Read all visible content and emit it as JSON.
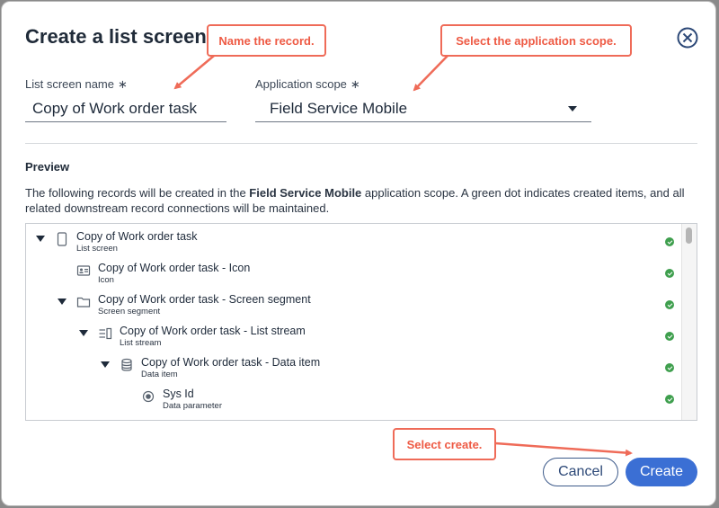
{
  "dialog": {
    "title": "Create a list screen"
  },
  "form": {
    "name_label": "List screen name",
    "required_marker": "∗",
    "name_value": "Copy of Work order task",
    "scope_label": "Application scope",
    "scope_value": "Field Service Mobile"
  },
  "preview": {
    "title": "Preview",
    "desc_before": "The following records will be created in the ",
    "desc_scope": "Field Service Mobile",
    "desc_after": " application scope. A green dot indicates created items, and all related downstream record connections will be maintained.",
    "items": [
      {
        "name": "Copy of Work order task",
        "type": "List screen",
        "icon": "mobile-screen-icon"
      },
      {
        "name": "Copy of Work order task - Icon",
        "type": "Icon",
        "icon": "id-card-icon"
      },
      {
        "name": "Copy of Work order task - Screen segment",
        "type": "Screen segment",
        "icon": "folder-icon"
      },
      {
        "name": "Copy of Work order task - List stream",
        "type": "List stream",
        "icon": "list-stream-icon"
      },
      {
        "name": "Copy of Work order task - Data item",
        "type": "Data item",
        "icon": "database-icon"
      },
      {
        "name": "Sys Id",
        "type": "Data parameter",
        "icon": "parameter-icon"
      }
    ],
    "created_color": "#3f9f4e"
  },
  "footer": {
    "cancel_label": "Cancel",
    "create_label": "Create"
  },
  "callouts": {
    "name": "Name the record.",
    "scope": "Select the application scope.",
    "create": "Select create."
  },
  "colors": {
    "accent": "#3b6fd4",
    "callout": "#ee5a44"
  }
}
